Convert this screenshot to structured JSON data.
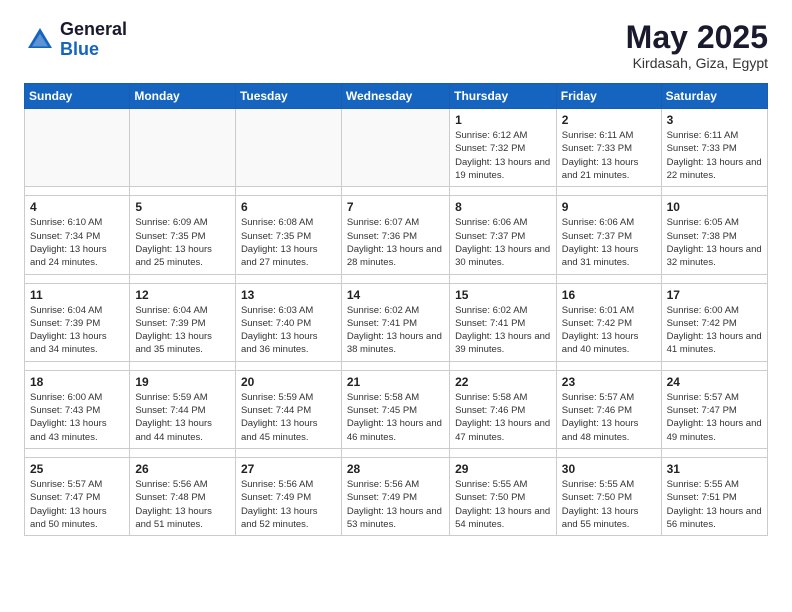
{
  "logo": {
    "general": "General",
    "blue": "Blue"
  },
  "title": "May 2025",
  "subtitle": "Kirdasah, Giza, Egypt",
  "days_of_week": [
    "Sunday",
    "Monday",
    "Tuesday",
    "Wednesday",
    "Thursday",
    "Friday",
    "Saturday"
  ],
  "weeks": [
    [
      {
        "day": "",
        "info": ""
      },
      {
        "day": "",
        "info": ""
      },
      {
        "day": "",
        "info": ""
      },
      {
        "day": "",
        "info": ""
      },
      {
        "day": "1",
        "info": "Sunrise: 6:12 AM\nSunset: 7:32 PM\nDaylight: 13 hours\nand 19 minutes."
      },
      {
        "day": "2",
        "info": "Sunrise: 6:11 AM\nSunset: 7:33 PM\nDaylight: 13 hours\nand 21 minutes."
      },
      {
        "day": "3",
        "info": "Sunrise: 6:11 AM\nSunset: 7:33 PM\nDaylight: 13 hours\nand 22 minutes."
      }
    ],
    [
      {
        "day": "4",
        "info": "Sunrise: 6:10 AM\nSunset: 7:34 PM\nDaylight: 13 hours\nand 24 minutes."
      },
      {
        "day": "5",
        "info": "Sunrise: 6:09 AM\nSunset: 7:35 PM\nDaylight: 13 hours\nand 25 minutes."
      },
      {
        "day": "6",
        "info": "Sunrise: 6:08 AM\nSunset: 7:35 PM\nDaylight: 13 hours\nand 27 minutes."
      },
      {
        "day": "7",
        "info": "Sunrise: 6:07 AM\nSunset: 7:36 PM\nDaylight: 13 hours\nand 28 minutes."
      },
      {
        "day": "8",
        "info": "Sunrise: 6:06 AM\nSunset: 7:37 PM\nDaylight: 13 hours\nand 30 minutes."
      },
      {
        "day": "9",
        "info": "Sunrise: 6:06 AM\nSunset: 7:37 PM\nDaylight: 13 hours\nand 31 minutes."
      },
      {
        "day": "10",
        "info": "Sunrise: 6:05 AM\nSunset: 7:38 PM\nDaylight: 13 hours\nand 32 minutes."
      }
    ],
    [
      {
        "day": "11",
        "info": "Sunrise: 6:04 AM\nSunset: 7:39 PM\nDaylight: 13 hours\nand 34 minutes."
      },
      {
        "day": "12",
        "info": "Sunrise: 6:04 AM\nSunset: 7:39 PM\nDaylight: 13 hours\nand 35 minutes."
      },
      {
        "day": "13",
        "info": "Sunrise: 6:03 AM\nSunset: 7:40 PM\nDaylight: 13 hours\nand 36 minutes."
      },
      {
        "day": "14",
        "info": "Sunrise: 6:02 AM\nSunset: 7:41 PM\nDaylight: 13 hours\nand 38 minutes."
      },
      {
        "day": "15",
        "info": "Sunrise: 6:02 AM\nSunset: 7:41 PM\nDaylight: 13 hours\nand 39 minutes."
      },
      {
        "day": "16",
        "info": "Sunrise: 6:01 AM\nSunset: 7:42 PM\nDaylight: 13 hours\nand 40 minutes."
      },
      {
        "day": "17",
        "info": "Sunrise: 6:00 AM\nSunset: 7:42 PM\nDaylight: 13 hours\nand 41 minutes."
      }
    ],
    [
      {
        "day": "18",
        "info": "Sunrise: 6:00 AM\nSunset: 7:43 PM\nDaylight: 13 hours\nand 43 minutes."
      },
      {
        "day": "19",
        "info": "Sunrise: 5:59 AM\nSunset: 7:44 PM\nDaylight: 13 hours\nand 44 minutes."
      },
      {
        "day": "20",
        "info": "Sunrise: 5:59 AM\nSunset: 7:44 PM\nDaylight: 13 hours\nand 45 minutes."
      },
      {
        "day": "21",
        "info": "Sunrise: 5:58 AM\nSunset: 7:45 PM\nDaylight: 13 hours\nand 46 minutes."
      },
      {
        "day": "22",
        "info": "Sunrise: 5:58 AM\nSunset: 7:46 PM\nDaylight: 13 hours\nand 47 minutes."
      },
      {
        "day": "23",
        "info": "Sunrise: 5:57 AM\nSunset: 7:46 PM\nDaylight: 13 hours\nand 48 minutes."
      },
      {
        "day": "24",
        "info": "Sunrise: 5:57 AM\nSunset: 7:47 PM\nDaylight: 13 hours\nand 49 minutes."
      }
    ],
    [
      {
        "day": "25",
        "info": "Sunrise: 5:57 AM\nSunset: 7:47 PM\nDaylight: 13 hours\nand 50 minutes."
      },
      {
        "day": "26",
        "info": "Sunrise: 5:56 AM\nSunset: 7:48 PM\nDaylight: 13 hours\nand 51 minutes."
      },
      {
        "day": "27",
        "info": "Sunrise: 5:56 AM\nSunset: 7:49 PM\nDaylight: 13 hours\nand 52 minutes."
      },
      {
        "day": "28",
        "info": "Sunrise: 5:56 AM\nSunset: 7:49 PM\nDaylight: 13 hours\nand 53 minutes."
      },
      {
        "day": "29",
        "info": "Sunrise: 5:55 AM\nSunset: 7:50 PM\nDaylight: 13 hours\nand 54 minutes."
      },
      {
        "day": "30",
        "info": "Sunrise: 5:55 AM\nSunset: 7:50 PM\nDaylight: 13 hours\nand 55 minutes."
      },
      {
        "day": "31",
        "info": "Sunrise: 5:55 AM\nSunset: 7:51 PM\nDaylight: 13 hours\nand 56 minutes."
      }
    ]
  ]
}
